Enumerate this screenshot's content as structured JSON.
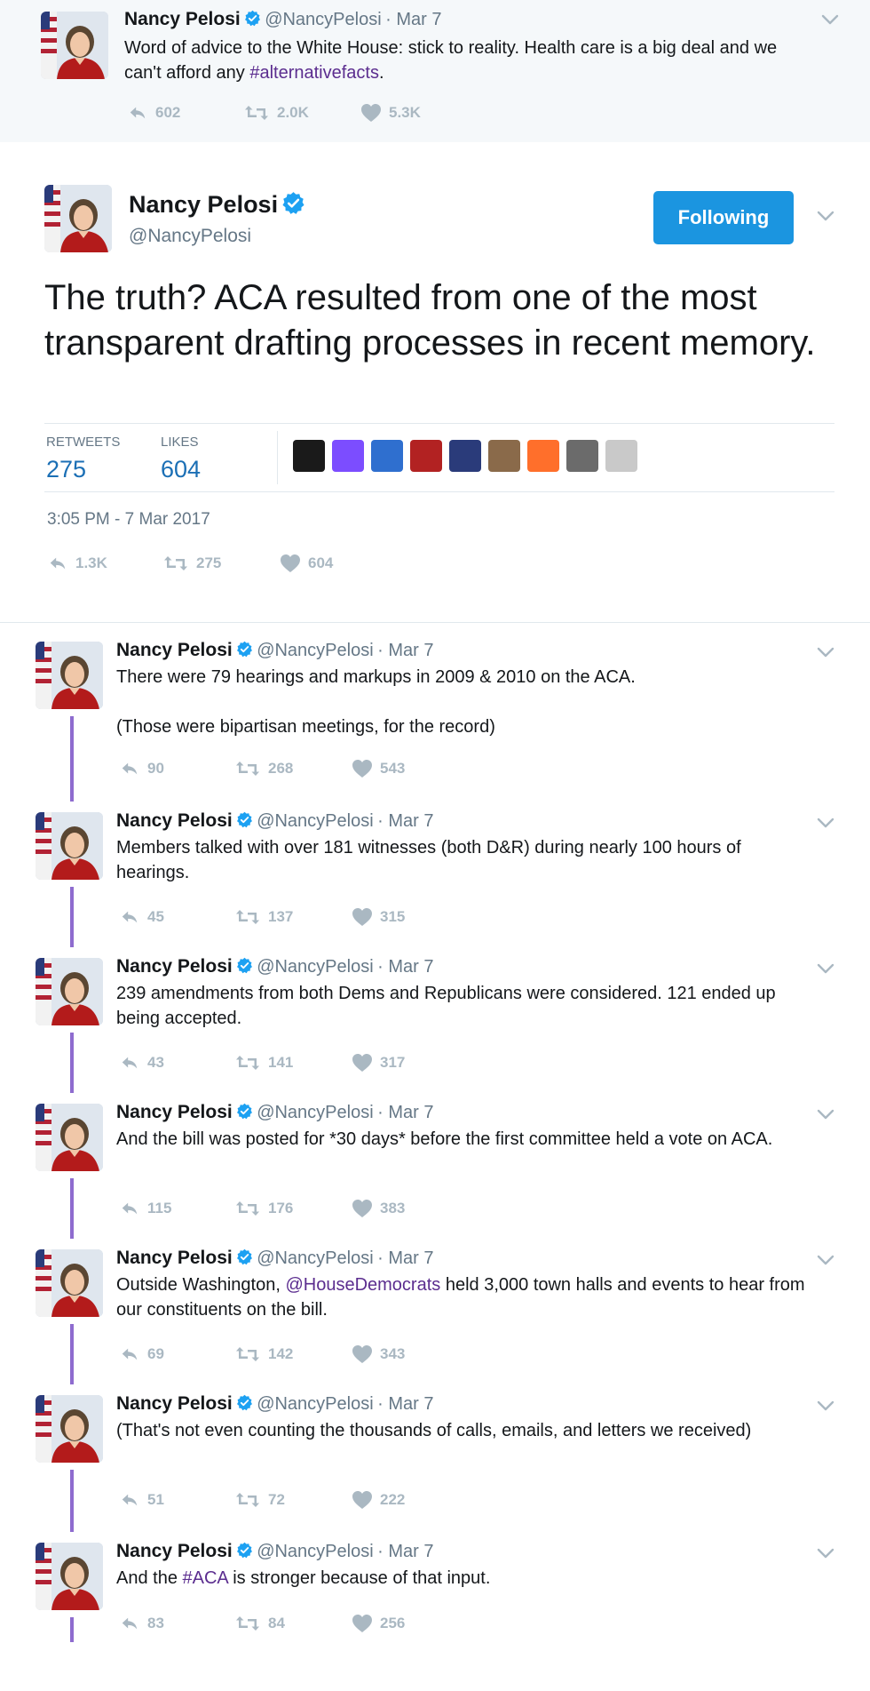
{
  "author": {
    "name": "Nancy Pelosi",
    "handle": "@NancyPelosi"
  },
  "top_tweet": {
    "date": "· Mar 7",
    "text_before": "Word of advice to the White House: stick to reality. Health care is a big deal and we can't afford any ",
    "hashtag": "#alternativefacts",
    "text_after": ".",
    "replies": "602",
    "retweets": "2.0K",
    "likes": "5.3K"
  },
  "main_tweet": {
    "follow_label": "Following",
    "text": "The truth? ACA resulted from one of the most transparent drafting processes in recent memory.",
    "retweets_label": "RETWEETS",
    "retweets_value": "275",
    "likes_label": "LIKES",
    "likes_value": "604",
    "timestamp": "3:05 PM - 7 Mar 2017",
    "replies": "1.3K",
    "retweets": "275",
    "likes": "604",
    "liker_avatar_colors": [
      "#1a1a1a",
      "#7c4dff",
      "#2f6fcf",
      "#b22222",
      "#2a3b7a",
      "#8a6a4a",
      "#ff6f2b",
      "#6b6b6b",
      "#c9c9c9"
    ]
  },
  "thread": [
    {
      "date": "· Mar 7",
      "text_parts": [
        {
          "t": "There were 79 hearings and markups in 2009 & 2010 on the ACA."
        },
        {
          "t": "\n\n(Those were bipartisan meetings, for the record)"
        }
      ],
      "replies": "90",
      "retweets": "268",
      "likes": "543"
    },
    {
      "date": "· Mar 7",
      "text_parts": [
        {
          "t": "Members talked with over 181 witnesses (both D&R) during nearly 100 hours of hearings."
        }
      ],
      "replies": "45",
      "retweets": "137",
      "likes": "315"
    },
    {
      "date": "· Mar 7",
      "text_parts": [
        {
          "t": "239 amendments from both Dems and Republicans were considered. 121 ended up being accepted."
        }
      ],
      "replies": "43",
      "retweets": "141",
      "likes": "317"
    },
    {
      "date": "· Mar 7",
      "text_parts": [
        {
          "t": "And the bill was posted for *30 days* before the first committee held a vote on ACA."
        }
      ],
      "replies": "115",
      "retweets": "176",
      "likes": "383"
    },
    {
      "date": "· Mar 7",
      "text_parts": [
        {
          "t": "Outside Washington, "
        },
        {
          "t": "@HouseDemocrats",
          "cls": "mention"
        },
        {
          "t": " held 3,000 town halls and events to hear from our constituents on the bill."
        }
      ],
      "replies": "69",
      "retweets": "142",
      "likes": "343"
    },
    {
      "date": "· Mar 7",
      "text_parts": [
        {
          "t": "(That's not even counting the thousands of calls, emails, and letters we received)"
        }
      ],
      "replies": "51",
      "retweets": "72",
      "likes": "222"
    },
    {
      "date": "· Mar 7",
      "text_parts": [
        {
          "t": "And the "
        },
        {
          "t": "#ACA",
          "cls": "hashtag"
        },
        {
          "t": " is stronger because of that input."
        }
      ],
      "replies": "83",
      "retweets": "84",
      "likes": "256"
    }
  ]
}
